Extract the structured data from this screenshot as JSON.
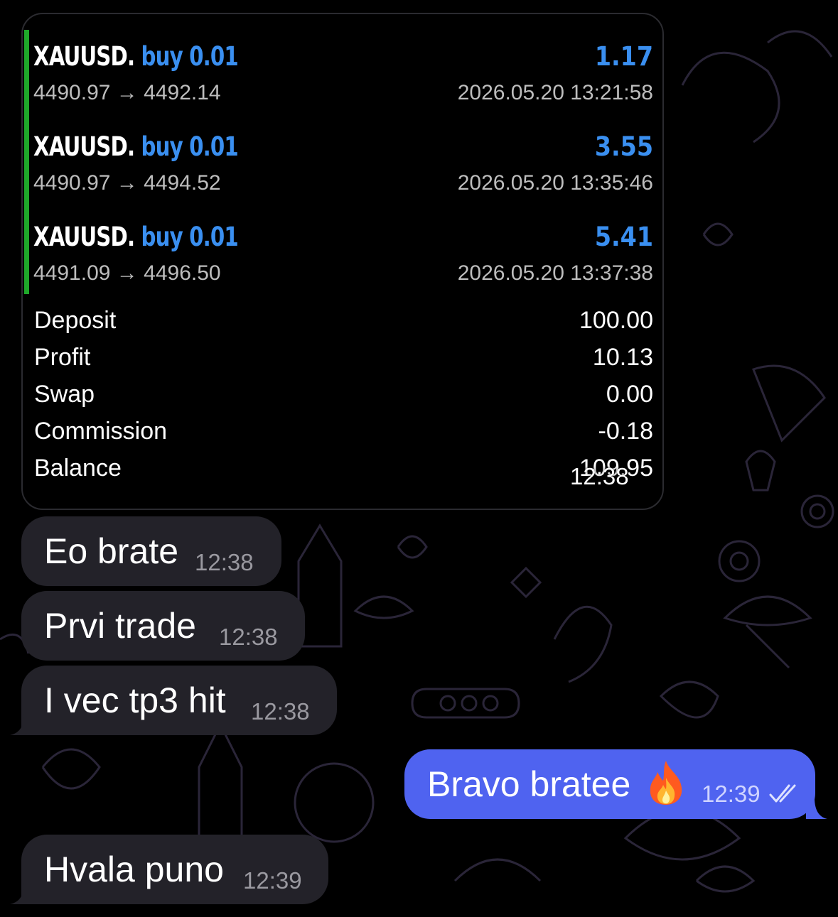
{
  "report": {
    "trades": [
      {
        "symbol": "XAUUSD.",
        "direction": "buy 0.01",
        "pnl": "1.17",
        "open": "4490.97",
        "close": "4492.14",
        "arrow": "→",
        "time": "2026.05.20 13:21:58"
      },
      {
        "symbol": "XAUUSD.",
        "direction": "buy 0.01",
        "pnl": "3.55",
        "open": "4490.97",
        "close": "4494.52",
        "arrow": "→",
        "time": "2026.05.20 13:35:46"
      },
      {
        "symbol": "XAUUSD.",
        "direction": "buy 0.01",
        "pnl": "5.41",
        "open": "4491.09",
        "close": "4496.50",
        "arrow": "→",
        "time": "2026.05.20 13:37:38"
      }
    ],
    "summary": [
      {
        "label": "Deposit",
        "value": "100.00"
      },
      {
        "label": "Profit",
        "value": "10.13"
      },
      {
        "label": "Swap",
        "value": "0.00"
      },
      {
        "label": "Commission",
        "value": "-0.18"
      },
      {
        "label": "Balance",
        "value": "109.95"
      }
    ],
    "timestamp": "12:38"
  },
  "messages": [
    {
      "text": "Eo brate",
      "time": "12:38"
    },
    {
      "text": "Prvi trade",
      "time": "12:38"
    },
    {
      "text": "I vec tp3 hit",
      "time": "12:38"
    },
    {
      "text": "Hvala puno",
      "time": "12:39"
    }
  ],
  "outgoing": {
    "text": "Bravo bratee",
    "time": "12:39",
    "status_icon": "double-check-icon",
    "emoji_icon": "fire-icon"
  },
  "colors": {
    "background": "#000000",
    "incoming": "#232229",
    "outgoing": "#4f63f0",
    "accent": "#3a8ff0",
    "positions_bar": "#1fa82a"
  }
}
